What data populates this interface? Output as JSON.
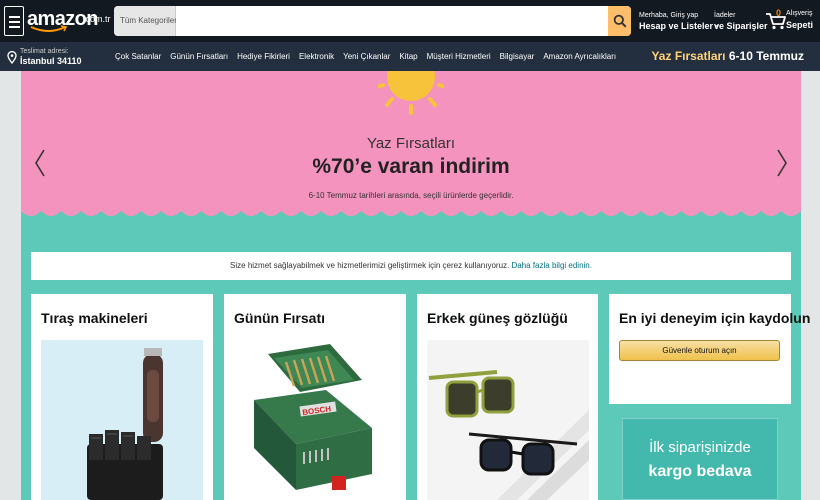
{
  "header": {
    "logo_text": "amazon",
    "logo_tld": ".com.tr",
    "search": {
      "category": "Tüm Kategoriler",
      "placeholder": "",
      "value": ""
    },
    "account": {
      "line1": "Merhaba, Giriş yap",
      "line2": "Hesap ve Listeler"
    },
    "orders": {
      "line1": "İadeler",
      "line2": "ve Siparişler"
    },
    "cart": {
      "count": "0",
      "line1": "Alışveriş",
      "line2": "Sepeti"
    }
  },
  "subnav": {
    "deliver_line1": "Teslimat adresi:",
    "deliver_line2": "İstanbul 34110",
    "links": [
      "Çok Satanlar",
      "Günün Fırsatları",
      "Hediye Fikirleri",
      "Elektronik",
      "Yeni Çıkanlar",
      "Kitap",
      "Müşteri Hizmetleri",
      "Bilgisayar",
      "Amazon Ayrıcalıkları"
    ],
    "promo_title": "Yaz Fırsatları",
    "promo_dates": "6-10 Temmuz"
  },
  "hero": {
    "title": "Yaz Fırsatları",
    "headline": "%70’e varan indirim",
    "subtitle": "6-10 Temmuz tarihleri arasında, seçili ürünlerde geçerlidir."
  },
  "cookie": {
    "text": "Size hizmet sağlayabilmek ve hizmetlerimizi geliştirmek için çerez kullanıyoruz.",
    "link": "Daha fazla bilgi edinin."
  },
  "cards": [
    {
      "title": "Tıraş makineleri"
    },
    {
      "title": "Günün Fırsatı",
      "product_brand": "BOSCH"
    },
    {
      "title": "Erkek güneş gözlüğü"
    },
    {
      "title": "En iyi deneyim için kaydolun",
      "button": "Güvenle oturum açın"
    }
  ],
  "ad": {
    "line1": "İlk siparişinizde",
    "line2": "kargo bedava"
  },
  "colors": {
    "nav_dark": "#131921",
    "nav_secondary": "#232f3e",
    "search_button": "#febd69",
    "hero_pink": "#f593bf",
    "hero_teal": "#5dc9b8",
    "link": "#007185",
    "cart_count": "#f08804"
  },
  "icons": [
    "menu-icon",
    "search-icon",
    "location-pin-icon",
    "cart-icon",
    "chevron-left-icon",
    "chevron-right-icon",
    "sun-icon"
  ]
}
